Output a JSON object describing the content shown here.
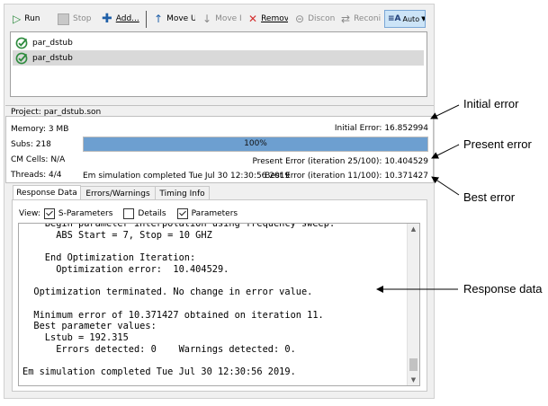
{
  "toolbar": {
    "run_label": "Run",
    "stop_label": "Stop",
    "add_label": "Add...",
    "move_up_label": "Move U",
    "move_down_label": "Move I",
    "remove_label": "Remov",
    "disconnect_label": "Discon",
    "reconnect_label": "Reconi",
    "auto_label": "Auto"
  },
  "jobs": [
    {
      "name": "par_dstub",
      "selected": false
    },
    {
      "name": "par_dstub",
      "selected": true
    }
  ],
  "project": {
    "label": "Project:",
    "file": "par_dstub.son"
  },
  "stats": {
    "memory": "Memory: 3 MB",
    "subs": "Subs: 218",
    "cm_cells": "CM Cells: N/A",
    "threads": "Threads: 4/4"
  },
  "errors": {
    "initial": "Initial Error: 16.852994",
    "progress_percent": 100,
    "progress_label": "100%",
    "present": "Present Error (iteration 25/100): 10.404529",
    "best": "Best Error (iteration 11/100): 10.371427",
    "completed": "Em simulation completed Tue Jul 30 12:30:56 2019"
  },
  "tabs": [
    {
      "label": "Response Data",
      "active": true
    },
    {
      "label": "Errors/Warnings",
      "active": false
    },
    {
      "label": "Timing Info",
      "active": false
    }
  ],
  "view": {
    "label": "View:",
    "options": [
      {
        "label": "S-Parameters",
        "checked": true
      },
      {
        "label": "Details",
        "checked": false
      },
      {
        "label": "Parameters",
        "checked": true
      }
    ]
  },
  "log_lines": [
    "    Begin parameter interpolation using frequency sweep:",
    "      ABS Start = 7, Stop = 10 GHZ",
    "",
    "    End Optimization Iteration:",
    "      Optimization error:  10.404529.",
    "",
    "  Optimization terminated. No change in error value.",
    "",
    "  Minimum error of 10.371427 obtained on iteration 11.",
    "  Best parameter values:",
    "    Lstub = 192.315",
    "      Errors detected: 0    Warnings detected: 0.",
    "",
    "Em simulation completed Tue Jul 30 12:30:56 2019."
  ],
  "callouts": {
    "initial_error": "Initial error",
    "present_error": "Present error",
    "best_error": "Best error",
    "response_data": "Response data"
  },
  "colors": {
    "progress_fill": "#6d9fd0",
    "selected_row": "#d9d9d9",
    "accent_green": "#2e8b3e",
    "remove_red": "#d32f2f",
    "add_blue": "#1f5fa8"
  }
}
